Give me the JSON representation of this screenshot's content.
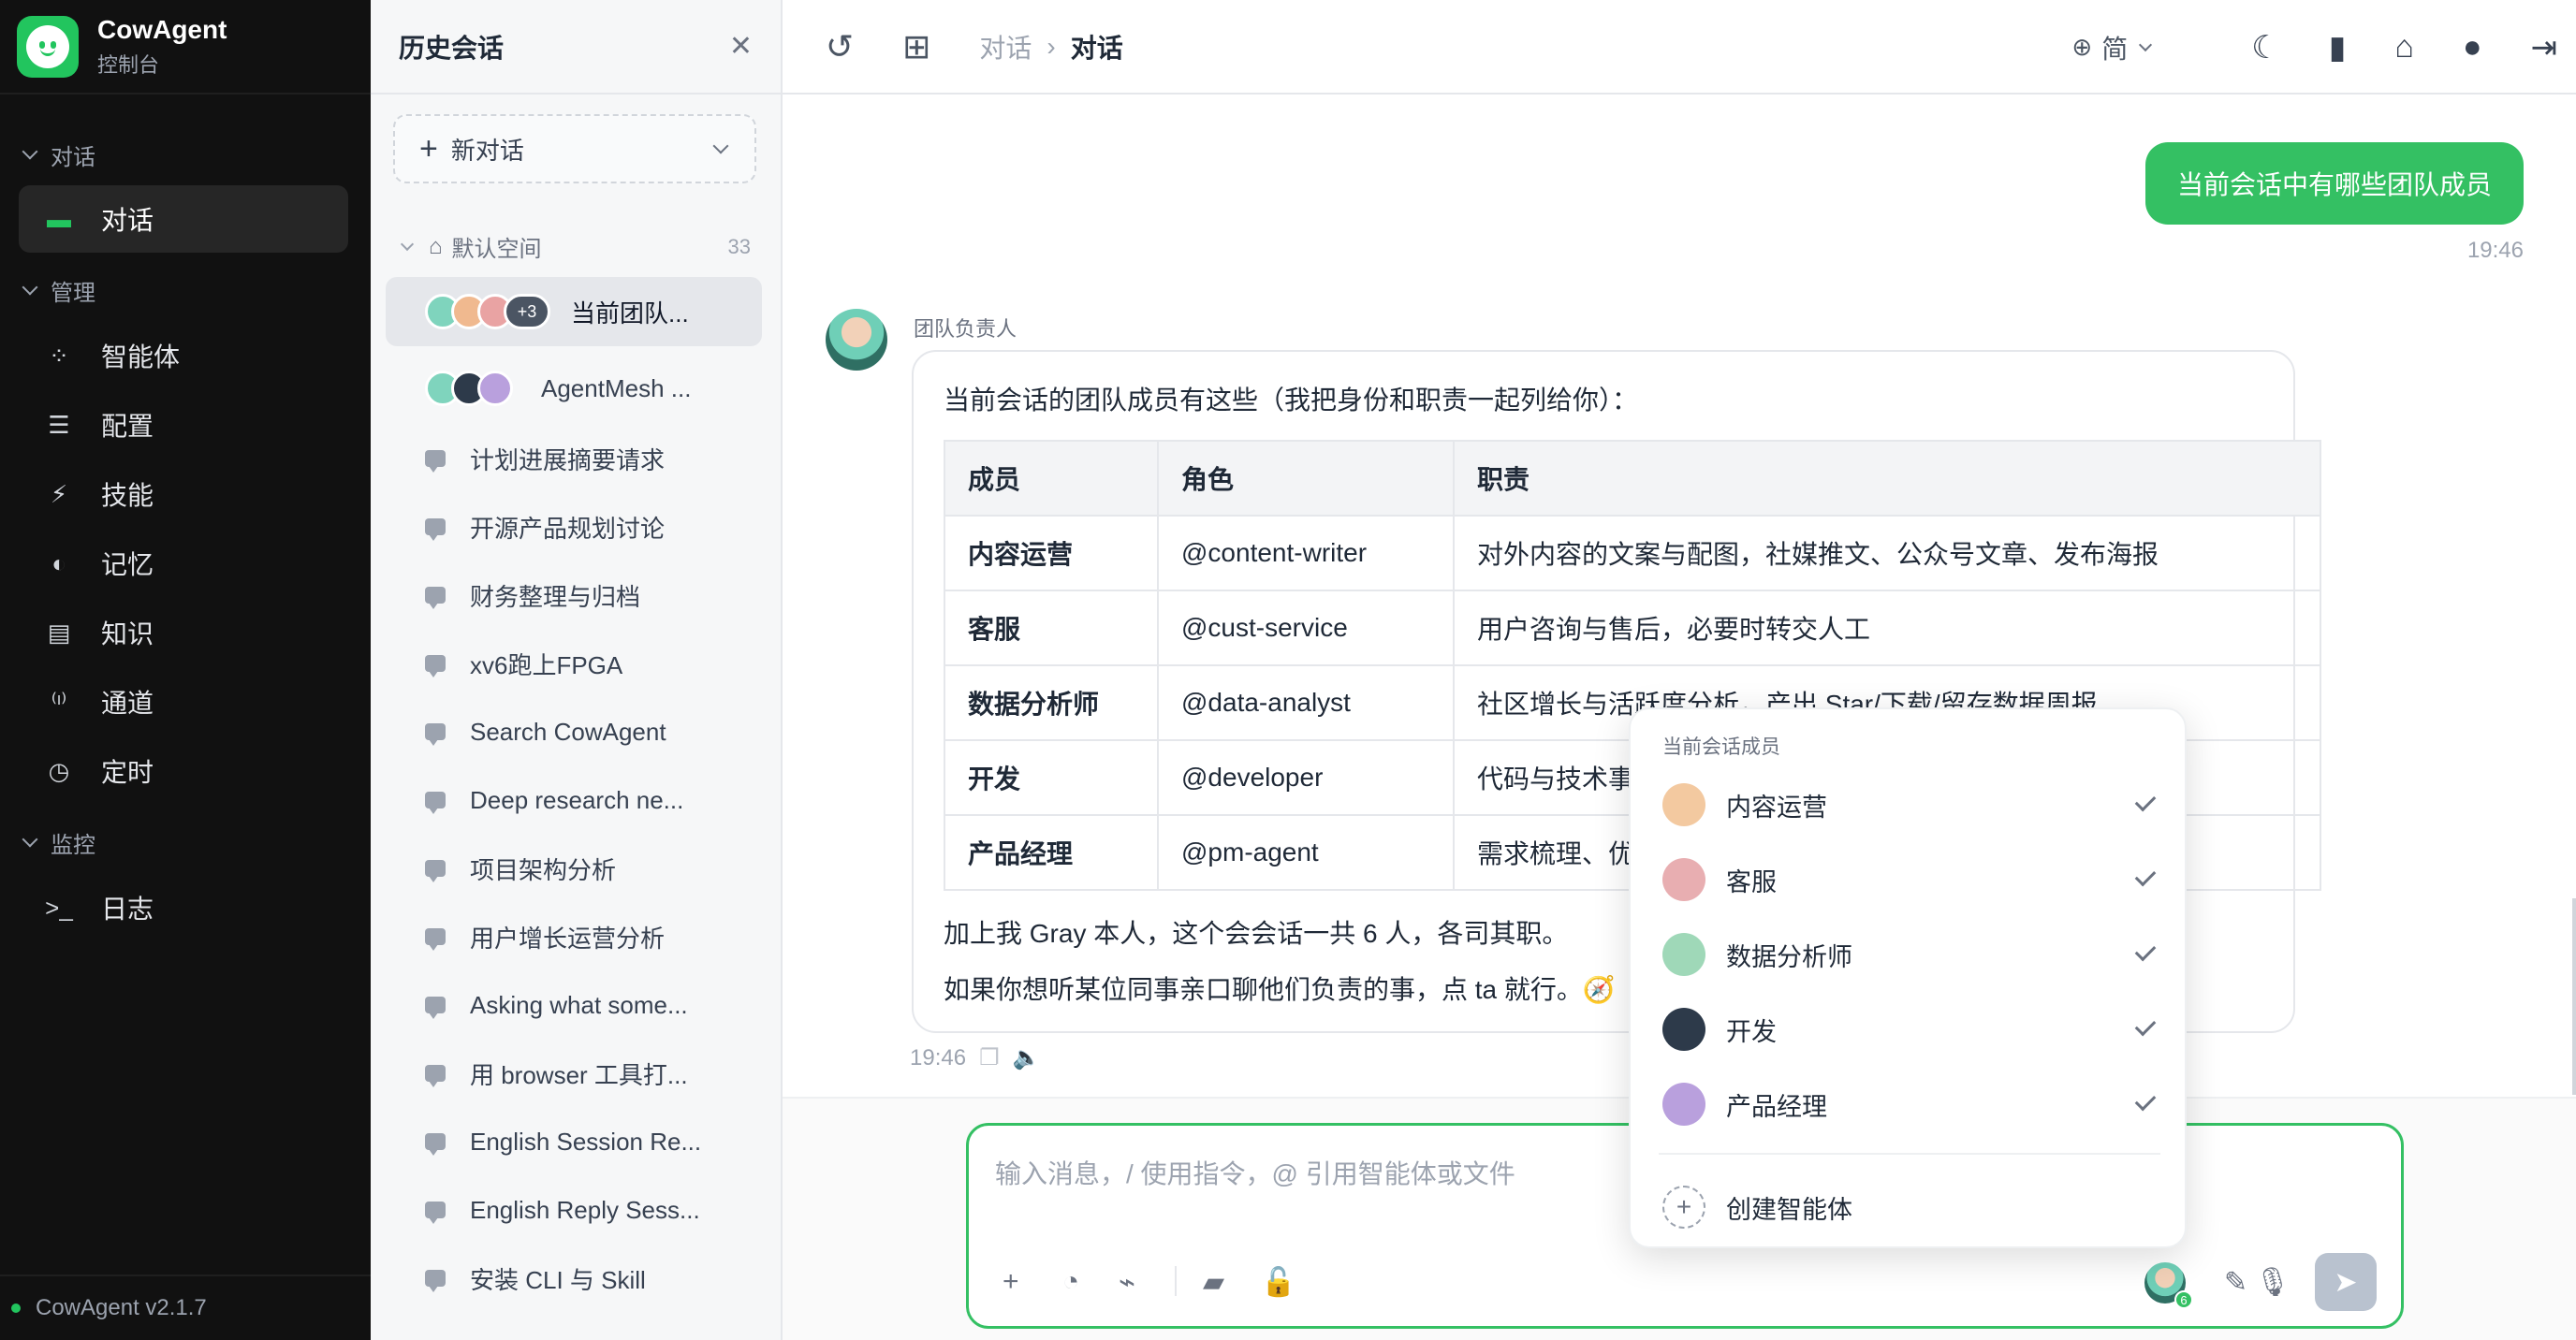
{
  "app": {
    "name": "CowAgent",
    "subtitle": "控制台",
    "version": "CowAgent v2.1.7"
  },
  "sidebar": {
    "groups": [
      {
        "label": "对话"
      },
      {
        "label": "管理"
      },
      {
        "label": "监控"
      }
    ],
    "items": [
      {
        "label": "对话",
        "icon": "chat-bubble-icon",
        "active": true
      },
      {
        "label": "智能体",
        "icon": "agents-icon"
      },
      {
        "label": "配置",
        "icon": "sliders-icon"
      },
      {
        "label": "技能",
        "icon": "lightning-icon"
      },
      {
        "label": "记忆",
        "icon": "brain-icon"
      },
      {
        "label": "知识",
        "icon": "book-icon"
      },
      {
        "label": "通道",
        "icon": "antenna-icon"
      },
      {
        "label": "定时",
        "icon": "clock-icon"
      },
      {
        "label": "日志",
        "icon": "terminal-icon"
      }
    ]
  },
  "history": {
    "title": "历史会话",
    "new_chat": "新对话",
    "space_name": "默认空间",
    "space_count": "33",
    "sessions": [
      {
        "label": "当前团队...",
        "more": "+3",
        "active": true
      },
      {
        "label": "AgentMesh ..."
      },
      {
        "label": "计划进展摘要请求"
      },
      {
        "label": "开源产品规划讨论"
      },
      {
        "label": "财务整理与归档"
      },
      {
        "label": "xv6跑上FPGA"
      },
      {
        "label": "Search CowAgent"
      },
      {
        "label": "Deep research ne..."
      },
      {
        "label": "项目架构分析"
      },
      {
        "label": "用户增长运营分析"
      },
      {
        "label": "Asking what some..."
      },
      {
        "label": "用 browser 工具打..."
      },
      {
        "label": "English Session Re..."
      },
      {
        "label": "English Reply Sess..."
      },
      {
        "label": "安装 CLI 与 Skill"
      }
    ]
  },
  "topbar": {
    "crumb_parent": "对话",
    "crumb_sep": "›",
    "crumb_current": "对话",
    "lang": "简"
  },
  "chat": {
    "user_message": "当前会话中有哪些团队成员",
    "user_time": "19:46",
    "bot_name": "团队负责人",
    "bot_intro": "当前会话的团队成员有这些（我把身份和职责一起列给你）：",
    "table": {
      "headers": [
        "成员",
        "角色",
        "职责"
      ],
      "rows": [
        [
          "内容运营",
          "@content-writer",
          "对外内容的文案与配图，社媒推文、公众号文章、发布海报"
        ],
        [
          "客服",
          "@cust-service",
          "用户咨询与售后，必要时转交人工"
        ],
        [
          "数据分析师",
          "@data-analyst",
          "社区增长与活跃度分析，产出 Star/下载/留存数据周报"
        ],
        [
          "开发",
          "@developer",
          "代码与技术事"
        ],
        [
          "产品经理",
          "@pm-agent",
          "需求梳理、优"
        ]
      ]
    },
    "line1": "加上我 Gray 本人，这个会会话一共 6 人，各司其职。",
    "line2": "如果你想听某位同事亲口聊他们负责的事，点 ta 就行。🧭",
    "bot_time": "19:46"
  },
  "composer": {
    "placeholder": "输入消息，/ 使用指令，@ 引用智能体或文件",
    "member_badge": "6"
  },
  "member_popup": {
    "title": "当前会话成员",
    "members": [
      {
        "name": "内容运营",
        "checked": true
      },
      {
        "name": "客服",
        "checked": true
      },
      {
        "name": "数据分析师",
        "checked": true
      },
      {
        "name": "开发",
        "checked": true
      },
      {
        "name": "产品经理",
        "checked": true
      }
    ],
    "create_label": "创建智能体"
  },
  "colors": {
    "accent": "#34c063",
    "sidebar_bg": "#111111",
    "send_disabled": "#b9c2cf"
  }
}
